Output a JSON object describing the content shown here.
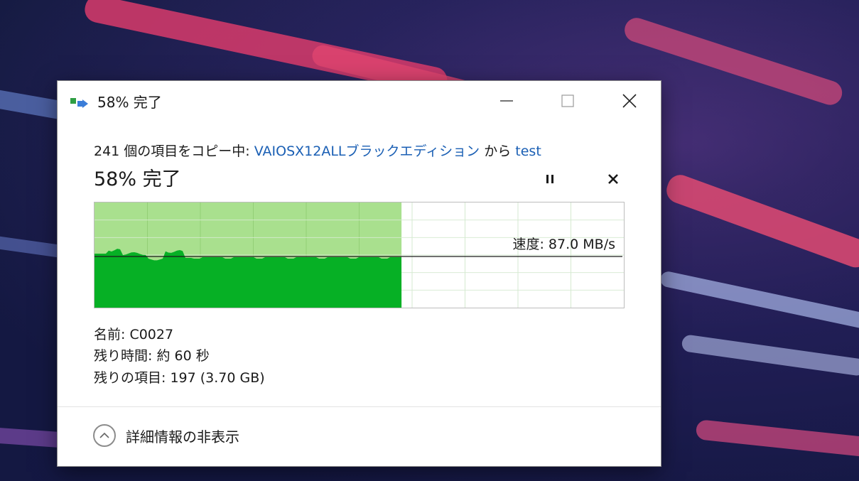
{
  "window": {
    "title": "58% 完了",
    "icon": "copy-transfer-icon",
    "minimize_icon": "minimize-icon",
    "maximize_icon": "maximize-icon",
    "close_icon": "close-icon"
  },
  "copy": {
    "prefix": "241 個の項目をコピー中: ",
    "source": "VAIOSX12ALLブラックエディション",
    "connector": " から ",
    "destination": "test"
  },
  "status": {
    "percent_text": "58% 完了",
    "progress_fraction": 0.58,
    "pause_icon": "pause-icon",
    "cancel_icon": "cancel-icon"
  },
  "speed_graph": {
    "speed_text": "速度: 87.0 MB/s"
  },
  "details": {
    "name_label": "名前:",
    "name_value": "C0027",
    "time_label": "残り時間:",
    "time_value": "約 60 秒",
    "items_label": "残りの項目:",
    "items_value": "197 (3.70 GB)"
  },
  "footer": {
    "toggle_label": "詳細情報の非表示",
    "toggle_icon": "chevron-up-icon"
  },
  "colors": {
    "progress_light": "#a9e08e",
    "progress_dark": "#06b025",
    "grid": "#d5ead0",
    "link": "#1a5fb4"
  }
}
